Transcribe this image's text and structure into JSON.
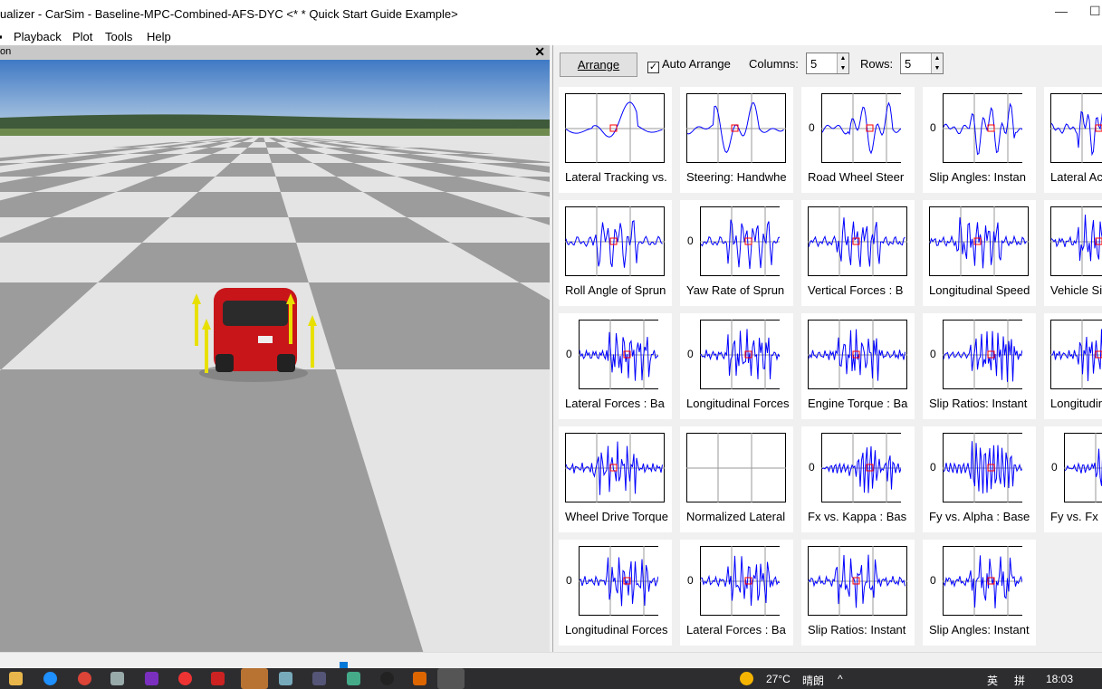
{
  "window": {
    "title": "ualizer - CarSim - Baseline-MPC-Combined-AFS-DYC <* * Quick Start Guide Example>"
  },
  "menu": [
    "Playback",
    "Plot",
    "Tools",
    "Help"
  ],
  "pane": {
    "title": "on",
    "close": "✕"
  },
  "toolbar": {
    "arrange": "Arrange",
    "auto_arrange": "Auto Arrange",
    "auto_checked": true,
    "columns_label": "Columns:",
    "columns": "5",
    "rows_label": "Rows:",
    "rows": "5"
  },
  "plots": [
    {
      "title": "Lateral Tracking vs.",
      "zero": ""
    },
    {
      "title": "Steering: Handwhe",
      "zero": ""
    },
    {
      "title": "Road Wheel Steer",
      "zero": "0"
    },
    {
      "title": "Slip Angles: Instan",
      "zero": "0"
    },
    {
      "title": "Lateral Ac",
      "zero": ""
    },
    {
      "title": "Roll Angle of Sprun",
      "zero": ""
    },
    {
      "title": "Yaw Rate of Sprun",
      "zero": "0"
    },
    {
      "title": "Vertical Forces : B",
      "zero": ""
    },
    {
      "title": "Longitudinal Speed",
      "zero": ""
    },
    {
      "title": "Vehicle Si",
      "zero": ""
    },
    {
      "title": "Lateral Forces : Ba",
      "zero": "0"
    },
    {
      "title": "Longitudinal Forces",
      "zero": "0"
    },
    {
      "title": "Engine Torque : Ba",
      "zero": ""
    },
    {
      "title": "Slip Ratios: Instant",
      "zero": "0"
    },
    {
      "title": "Longitudin",
      "zero": ""
    },
    {
      "title": "Wheel Drive Torque",
      "zero": ""
    },
    {
      "title": "Normalized Lateral",
      "zero": ""
    },
    {
      "title": "Fx vs. Kappa : Bas",
      "zero": "0"
    },
    {
      "title": "Fy vs. Alpha : Base",
      "zero": "0"
    },
    {
      "title": "Fy vs. Fx",
      "zero": "0"
    },
    {
      "title": "Longitudinal Forces",
      "zero": "0"
    },
    {
      "title": "Lateral Forces : Ba",
      "zero": "0"
    },
    {
      "title": "Slip Ratios: Instant",
      "zero": ""
    },
    {
      "title": "Slip Angles: Instant",
      "zero": "0"
    }
  ],
  "taskbar": {
    "weather": "27°C",
    "weather_text": "晴朗",
    "ime": "英",
    "ime2": "拼",
    "time": "18:03"
  },
  "colors": {
    "plot_line": "#0000ff",
    "marker": "#ff0000",
    "taskbar": "#2d2d30",
    "car": "#cc1a1a",
    "arrow": "#e8e000"
  }
}
